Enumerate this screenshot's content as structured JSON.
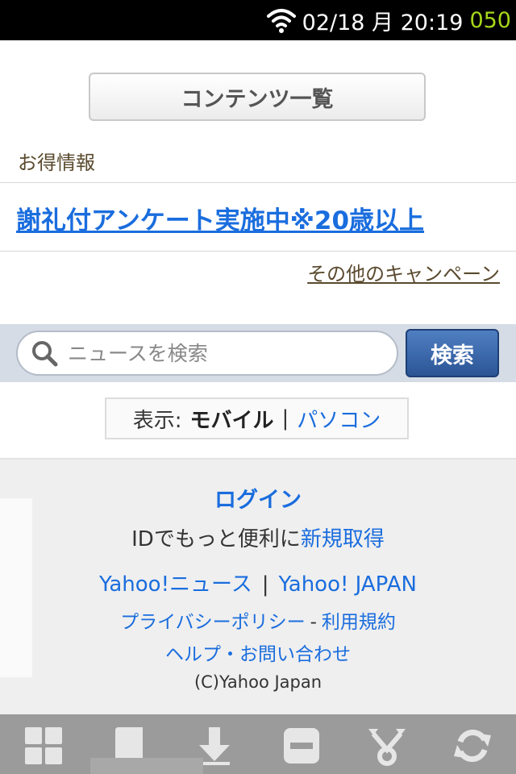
{
  "status_bar": {
    "datetime": "02/18 月 20:19",
    "battery": "050",
    "icons": [
      "wifi-icon"
    ]
  },
  "content": {
    "contents_button": "コンテンツ一覧",
    "section_title": "お得情報",
    "campaign_link": "謝礼付アンケート実施中※20歳以上",
    "more_campaigns": "その他のキャンペーン"
  },
  "search": {
    "placeholder": "ニュースを検索",
    "button": "検索"
  },
  "display": {
    "label": "表示:",
    "current": "モバイル",
    "separator": "|",
    "alternate": "パソコン"
  },
  "footer": {
    "login": "ログイン",
    "id_text": "IDでもっと便利に",
    "register": "新規取得",
    "news_link": "Yahoo!ニュース",
    "links_separator": "|",
    "japan_link": "Yahoo! JAPAN",
    "privacy": "プライバシーポリシー",
    "policy_separator": "-",
    "terms": "利用規約",
    "help": "ヘルプ・お問い合わせ",
    "copyright": "(C)Yahoo Japan"
  },
  "toolbar": {
    "icons": [
      "grid-icon",
      "book-icon",
      "download-icon",
      "minus-icon",
      "share-icon",
      "refresh-icon"
    ]
  },
  "colors": {
    "link": "#1a6dde",
    "battery": "#a6d61a",
    "search_button": "#2b5595",
    "toolbar": "#9b9b9b"
  }
}
